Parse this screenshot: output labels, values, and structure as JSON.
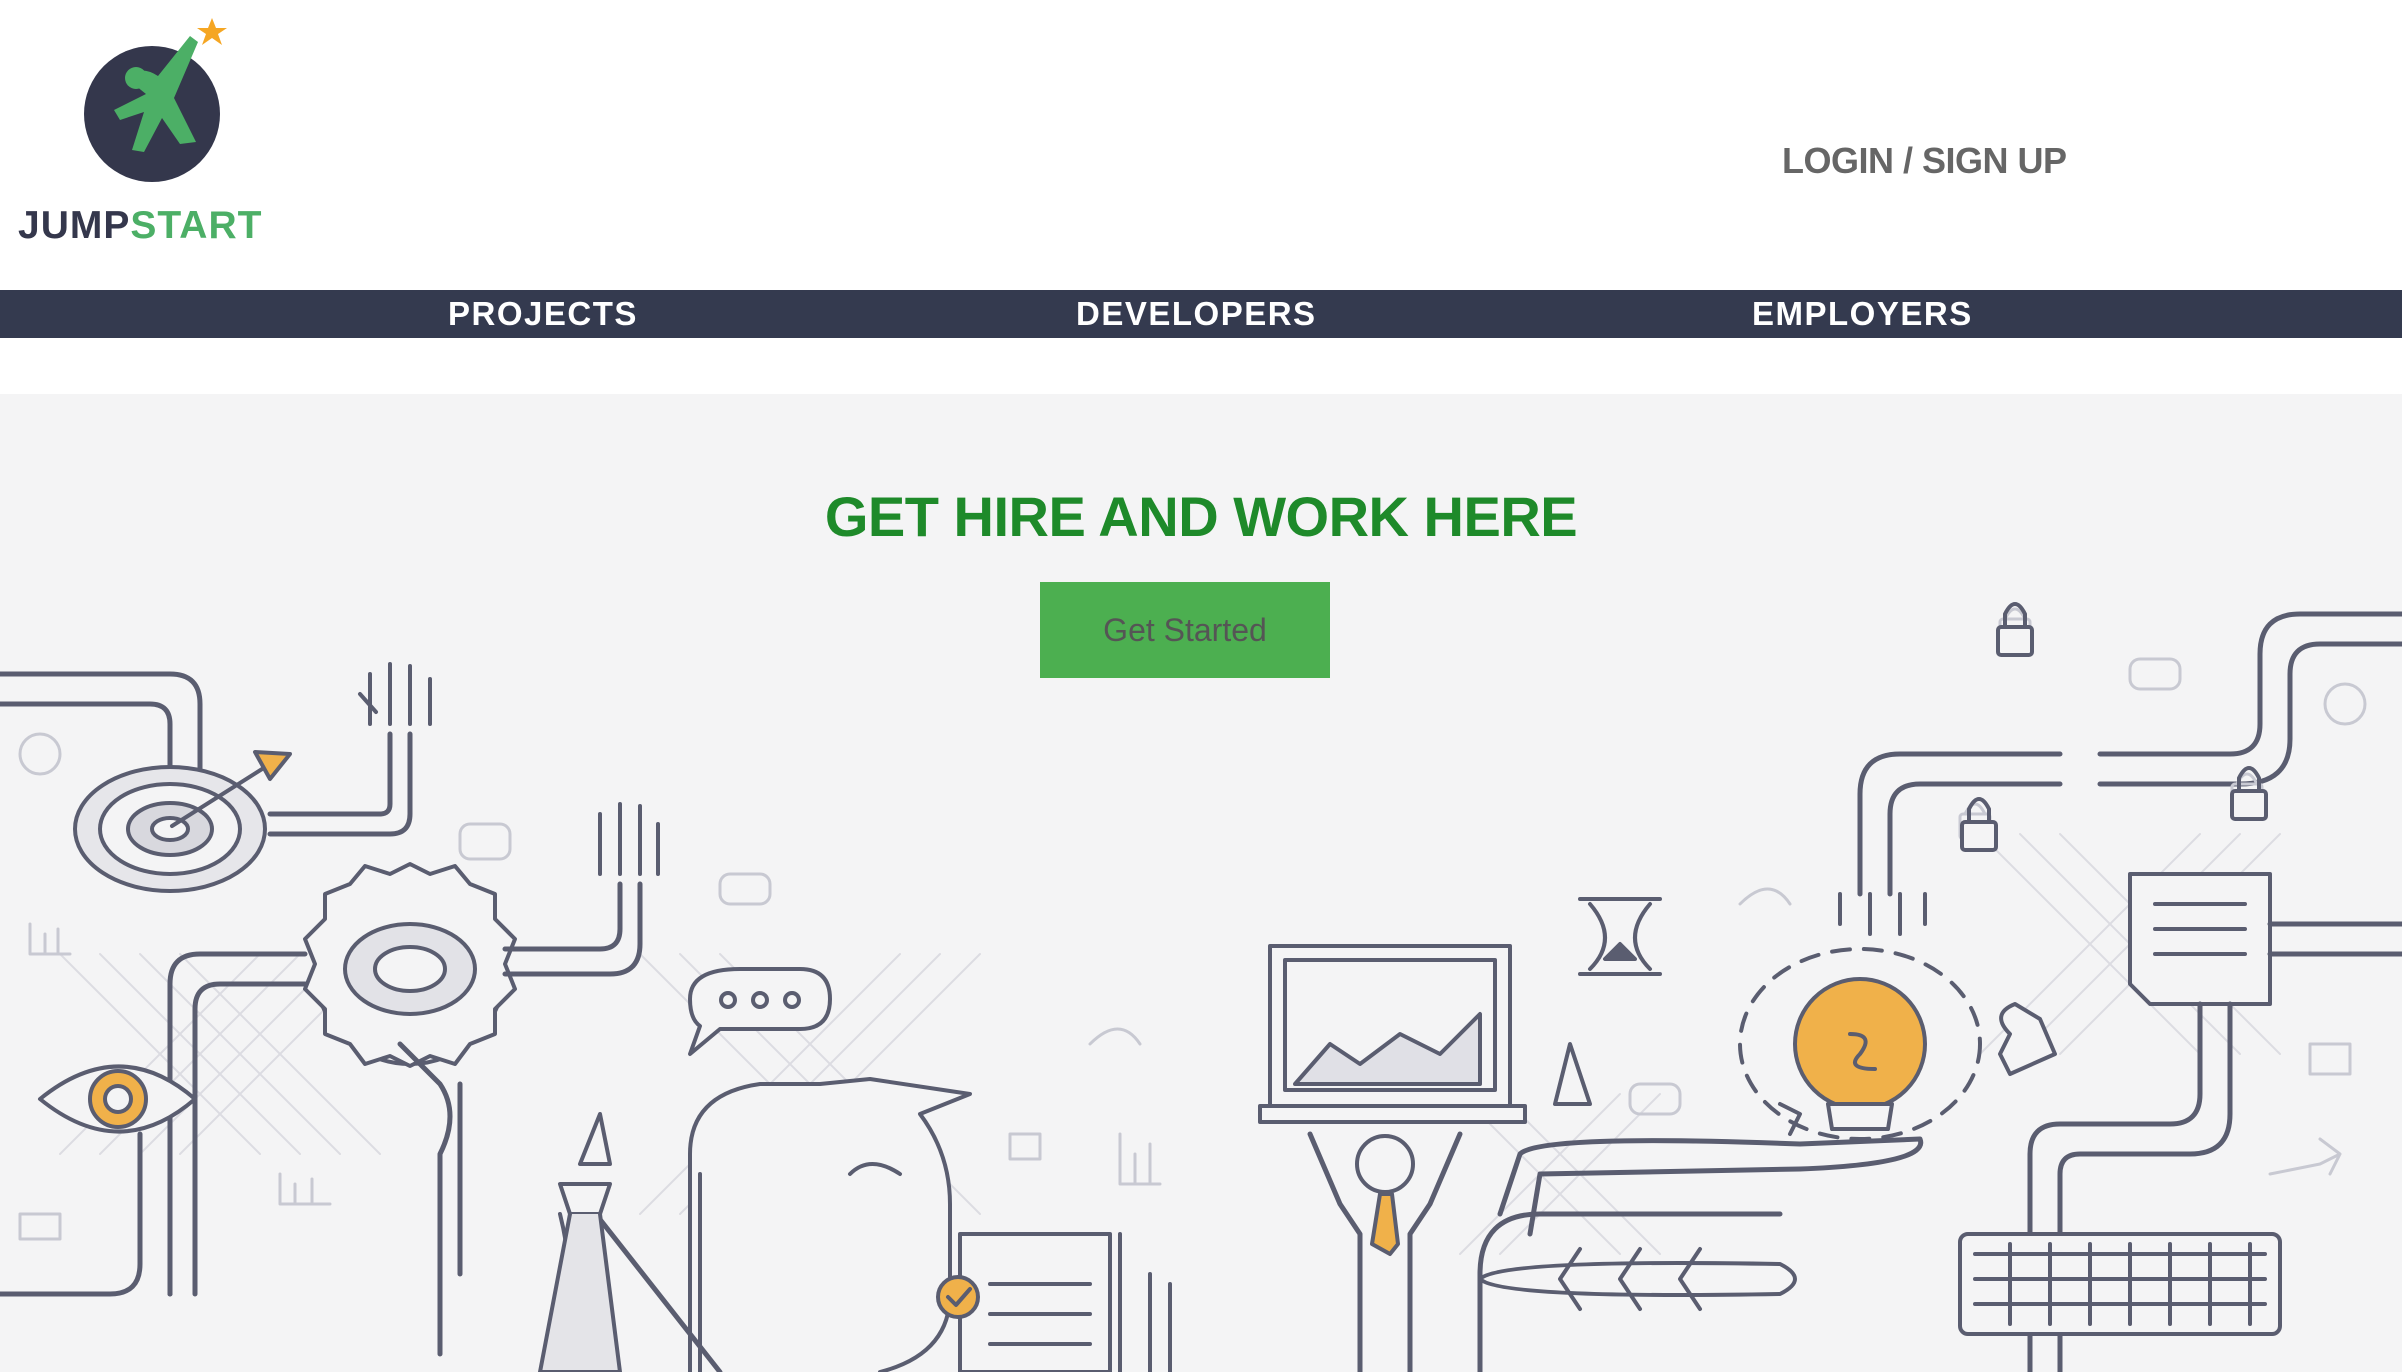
{
  "brand": {
    "name_part1": "JUMP",
    "name_part2": "START",
    "colors": {
      "dark": "#34374c",
      "green": "#4caf66",
      "star": "#f5a623"
    }
  },
  "header": {
    "auth_link": "LOGIN / SIGN UP"
  },
  "nav": {
    "items": [
      {
        "label": "PROJECTS"
      },
      {
        "label": "DEVELOPERS"
      },
      {
        "label": "EMPLOYERS"
      }
    ],
    "background": "#343a4f"
  },
  "hero": {
    "title": "GET HIRE AND WORK HERE",
    "cta_label": "Get Started",
    "title_color": "#1e8a2a",
    "cta_color": "#4caf50",
    "illustration": "line-art-business-doodles"
  }
}
